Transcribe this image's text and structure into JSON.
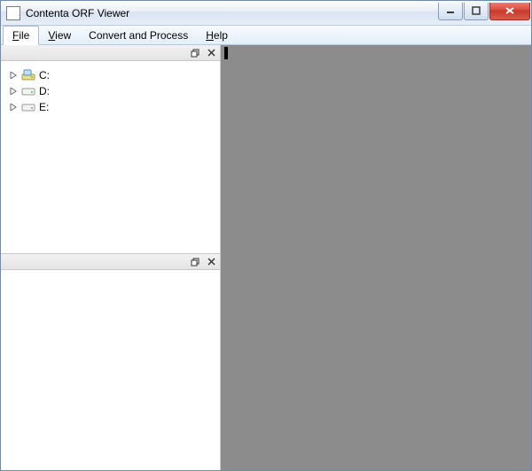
{
  "window": {
    "title": "Contenta ORF Viewer"
  },
  "menu": {
    "file": {
      "label": "File",
      "hotkey_index": 0
    },
    "view": {
      "label": "View",
      "hotkey_index": 0
    },
    "convert": {
      "label": "Convert and Process",
      "hotkey_index": -1
    },
    "help": {
      "label": "Help",
      "hotkey_index": 0
    }
  },
  "tree": {
    "items": [
      {
        "label": "C:",
        "icon": "drive-system"
      },
      {
        "label": "D:",
        "icon": "drive"
      },
      {
        "label": "E:",
        "icon": "drive"
      }
    ]
  }
}
